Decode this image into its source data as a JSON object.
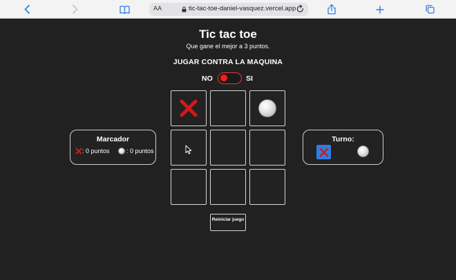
{
  "browser": {
    "text_size_label": "AA",
    "url": "tic-tac-toe-daniel-vasquez.vercel.app"
  },
  "page": {
    "title": "Tic tac toe",
    "subtitle": "Que gane el mejor a 3 puntos.",
    "mode_label": "JUGAR CONTRA LA MAQUINA",
    "toggle": {
      "off_label": "NO",
      "on_label": "SI",
      "state": "off"
    }
  },
  "board": {
    "cells": [
      "X",
      "",
      "O",
      "",
      "",
      "",
      "",
      "",
      ""
    ]
  },
  "score": {
    "title": "Marcador",
    "x_points": ": 0 puntos",
    "o_points": ": 0 puntos"
  },
  "turn": {
    "title": "Turno:",
    "current": "X"
  },
  "reset_button": {
    "label": "Reiniciar juego"
  },
  "colors": {
    "x": "#d11a1a",
    "accent": "#2f7de1",
    "toggle": "#e53935"
  },
  "icons": [
    "back-icon",
    "forward-icon",
    "bookmarks-icon",
    "lock-icon",
    "reload-icon",
    "share-icon",
    "new-tab-icon",
    "tabs-icon",
    "x-mark-icon",
    "o-orb-icon",
    "cursor-icon"
  ]
}
